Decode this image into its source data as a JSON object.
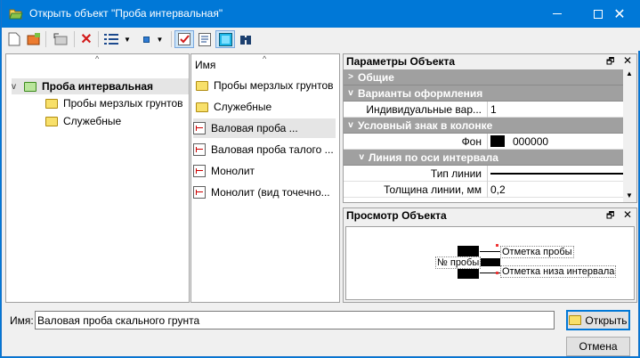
{
  "window": {
    "title": "Открыть объект \"Проба интервальная\"",
    "min_icon": "minimize-icon",
    "max_icon": "maximize-icon",
    "close_icon": "close-icon"
  },
  "toolbar": {
    "icons": [
      "new-doc-icon",
      "open-folder-icon",
      "up-level-icon",
      "delete-icon",
      "view-list-icon",
      "view-small-icon",
      "checklist-icon",
      "properties-icon",
      "preview-icon",
      "binoculars-icon"
    ]
  },
  "tree": {
    "root": "Проба интервальная",
    "children": [
      "Пробы мерзлых грунтов",
      "Служебные"
    ]
  },
  "list": {
    "header": "Имя",
    "items": [
      {
        "label": "Пробы мерзлых грунтов",
        "type": "folder"
      },
      {
        "label": "Служебные",
        "type": "folder"
      },
      {
        "label": "Валовая проба ...",
        "type": "object",
        "selected": true
      },
      {
        "label": "Валовая проба талого ...",
        "type": "object"
      },
      {
        "label": "Монолит",
        "type": "object"
      },
      {
        "label": "Монолит (вид точечно...",
        "type": "object"
      }
    ]
  },
  "params": {
    "title": "Параметры Объекта",
    "rows": [
      {
        "k": "Общие",
        "cat": true,
        "exp": ">"
      },
      {
        "k": "Варианты оформления",
        "cat": true,
        "exp": "v"
      },
      {
        "k": "Индивидуальные вар...",
        "v": "1"
      },
      {
        "k": "Условный знак в колонке",
        "cat": true,
        "exp": "v"
      },
      {
        "k": "Фон",
        "v": "000000",
        "swatch": "#000000"
      },
      {
        "k": "Линия по оси интервала",
        "cat": true,
        "exp": "v",
        "sub": true
      },
      {
        "k": "Тип линии",
        "v": "",
        "line": true
      },
      {
        "k": "Толщина линии, мм",
        "v": "0,2"
      }
    ]
  },
  "preview": {
    "title": "Просмотр Объекта",
    "label_num": "№ пробы",
    "label_top": "Отметка пробы",
    "label_bottom": "Отметка низа интервала"
  },
  "footer": {
    "name_label": "Имя:",
    "name_value": "Валовая проба скального грунта",
    "open_label": "Открыть",
    "cancel_label": "Отмена"
  },
  "colors": {
    "title_bar": "#0078d7",
    "category_bg": "#a0a0a0",
    "accent": "#0078d7"
  }
}
